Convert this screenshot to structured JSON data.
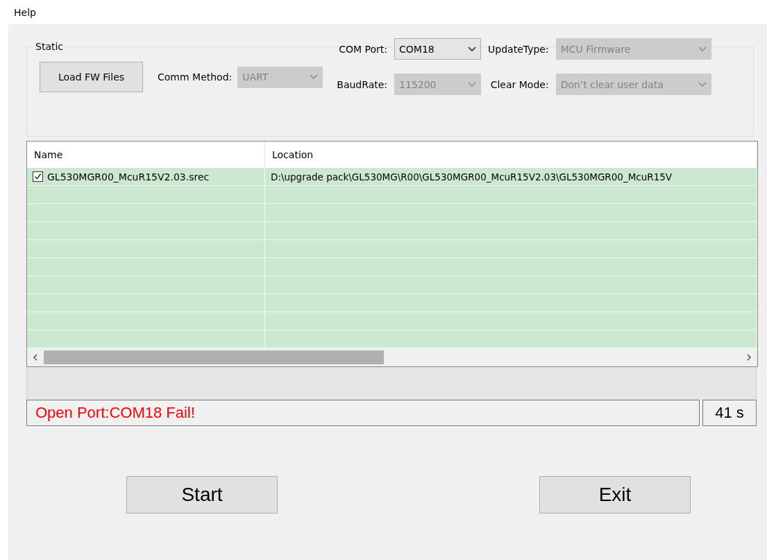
{
  "menu": [
    "Help"
  ],
  "group": {
    "title": "Static"
  },
  "load_button": "Load FW Files",
  "fields": [
    {
      "label": "Comm Method:",
      "value": "UART",
      "disabled": true
    },
    {
      "label": "COM Port:",
      "value": "COM18",
      "disabled": false
    },
    {
      "label": "UpdateType:",
      "value": "MCU Firmware",
      "disabled": true
    },
    {
      "label": "BaudRate:",
      "value": "115200",
      "disabled": true
    },
    {
      "label": "Clear Mode:",
      "value": "Don’t clear user data",
      "disabled": true
    }
  ],
  "table": {
    "columns": [
      "Name",
      "Location"
    ],
    "rows": [
      {
        "name": "GL530MGR00_McuR15V2.03.srec",
        "location": "D:\\upgrade pack\\GL530MG\\R00\\GL530MGR00_McuR15V2.03\\GL530MGR00_McuR15V",
        "checked": true
      }
    ]
  },
  "status": {
    "message": "Open Port:COM18 Fail!",
    "timer": "41 s"
  },
  "buttons": [
    "Start",
    "Exit"
  ]
}
